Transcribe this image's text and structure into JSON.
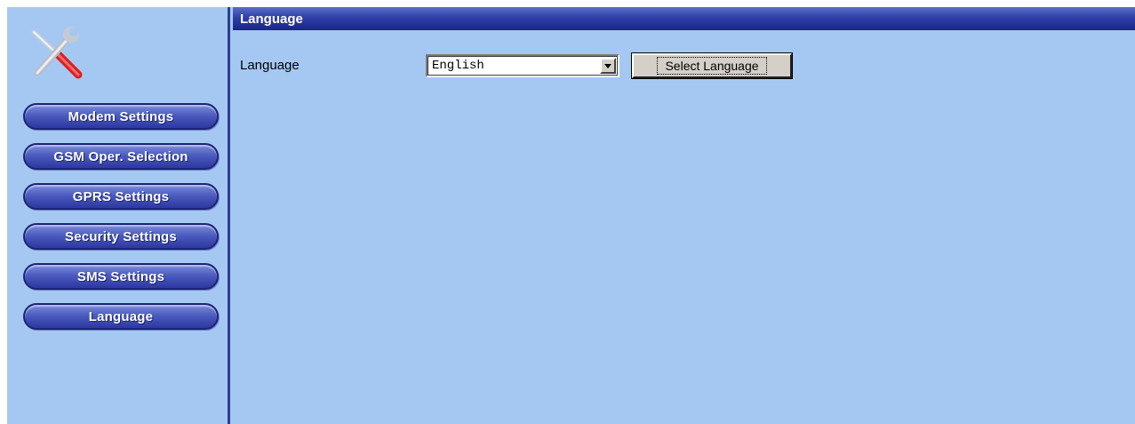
{
  "sidebar": {
    "logo_icon": "tools-icon",
    "items": [
      {
        "label": "Modem Settings"
      },
      {
        "label": "GSM Oper. Selection"
      },
      {
        "label": "GPRS Settings"
      },
      {
        "label": "Security Settings"
      },
      {
        "label": "SMS Settings"
      },
      {
        "label": "Language"
      }
    ]
  },
  "main": {
    "title": "Language",
    "field_label": "Language",
    "select_value": "English",
    "button_label": "Select Language"
  },
  "colors": {
    "background": "#a5c8f3",
    "titlebar": "#2f3fa7",
    "nav_button": "#3e4db5"
  }
}
